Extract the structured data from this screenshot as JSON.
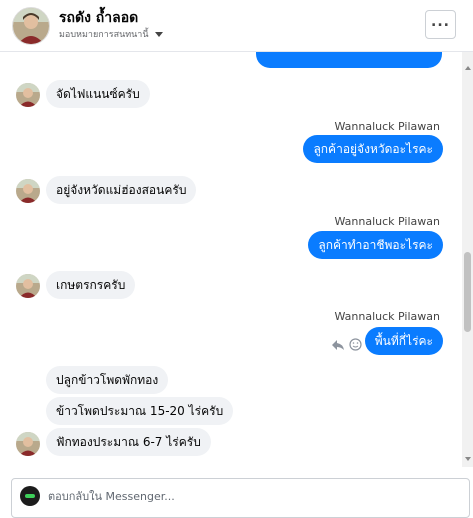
{
  "header": {
    "name": "รถดัง ถ้ำลอด",
    "subtitle": "มอบหมายการสนทนานี้"
  },
  "thread": {
    "messages": [
      {
        "dir": "out",
        "text": "",
        "partial": true
      },
      {
        "dir": "in",
        "text": "จัดไฟแนนซ์ครับ"
      },
      {
        "dir": "out",
        "sender": "Wannaluck Pilawan",
        "text": "ลูกค้าอยู่จังหวัดอะไรคะ"
      },
      {
        "dir": "in",
        "text": "อยู่จังหวัดแม่ฮ่องสอนครับ"
      },
      {
        "dir": "out",
        "sender": "Wannaluck Pilawan",
        "text": "ลูกค้าทำอาชีพอะไรคะ"
      },
      {
        "dir": "in",
        "text": "เกษตรกรครับ"
      },
      {
        "dir": "out",
        "sender": "Wannaluck Pilawan",
        "text": "พื้นที่กี่ไร่คะ"
      },
      {
        "dir": "in",
        "text": "ปลูกข้าวโพดพักทอง"
      },
      {
        "dir": "in",
        "text": "ข้าวโพดประมาณ 15-20 ไร่ครับ"
      },
      {
        "dir": "in",
        "text": "ฟักทองประมาณ 6-7 ไร่ครับ"
      }
    ]
  },
  "composer": {
    "placeholder": "ตอบกลับใน Messenger..."
  },
  "icons": {
    "more": "more-options-icon",
    "reply": "reply-icon",
    "react": "smiley-icon",
    "caret": "caret-down-icon"
  },
  "colors": {
    "outgoing_bubble": "#0a7cff",
    "incoming_bubble": "#f0f2f5"
  }
}
